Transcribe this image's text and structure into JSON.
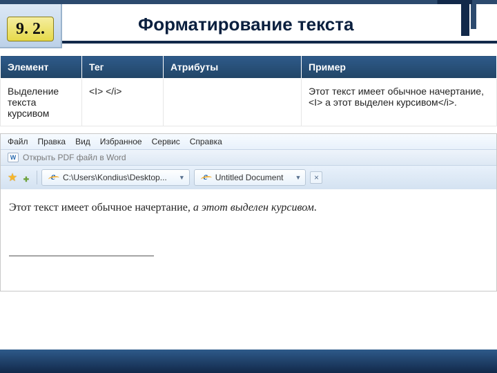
{
  "header": {
    "badge": "9. 2.",
    "title": "Форматирование текста"
  },
  "table": {
    "headers": {
      "element": "Элемент",
      "tag": "Тег",
      "attributes": "Атрибуты",
      "example": "Пример"
    },
    "row": {
      "element": "Выделение текста курсивом",
      "tag": "<I> </i>",
      "attributes": "",
      "example": "Этот текст имеет обычное начертание, <I> а этот выделен курсивом</i>."
    }
  },
  "browser": {
    "menu": {
      "file": "Файл",
      "edit": "Правка",
      "view": "Вид",
      "favorites": "Избранное",
      "tools": "Сервис",
      "help": "Справка"
    },
    "pdf_bar": "Открыть PDF файл в  Word",
    "tabs": {
      "path": "C:\\Users\\Kondius\\Desktop...",
      "title": "Untitled Document"
    },
    "newtab_glyph": "×",
    "content": {
      "normal": "Этот текст имеет обычное начертание, ",
      "italic": "а этот выделен курсивом",
      "period": "."
    }
  }
}
